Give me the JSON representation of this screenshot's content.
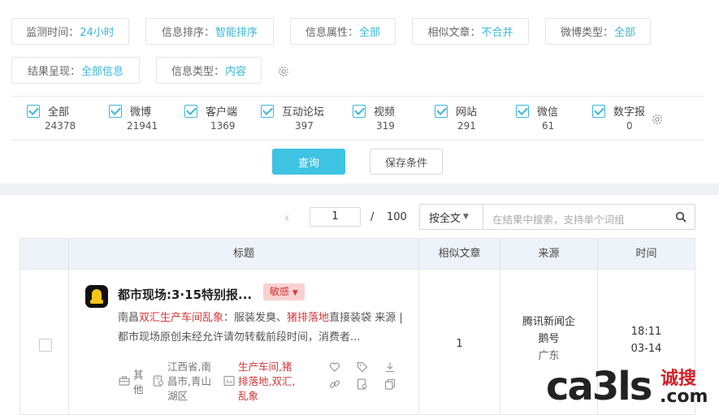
{
  "filters": {
    "monitor_time": {
      "label": "监测时间：",
      "value": "24小时"
    },
    "info_sort": {
      "label": "信息排序：",
      "value": "智能排序"
    },
    "info_attr": {
      "label": "信息属性：",
      "value": "全部"
    },
    "similar": {
      "label": "相似文章：",
      "value": "不合并"
    },
    "weibo_type": {
      "label": "微博类型：",
      "value": "全部"
    },
    "result_show": {
      "label": "结果呈现：",
      "value": "全部信息"
    },
    "info_type": {
      "label": "信息类型：",
      "value": "内容"
    }
  },
  "sources": [
    {
      "name": "全部",
      "count": "24378"
    },
    {
      "name": "微博",
      "count": "21941"
    },
    {
      "name": "客户端",
      "count": "1369"
    },
    {
      "name": "互动论坛",
      "count": "397"
    },
    {
      "name": "视频",
      "count": "319"
    },
    {
      "name": "网站",
      "count": "291"
    },
    {
      "name": "微信",
      "count": "61"
    },
    {
      "name": "数字报",
      "count": "0"
    }
  ],
  "buttons": {
    "query": "查询",
    "save": "保存条件"
  },
  "pager": {
    "prev": "‹",
    "current": "1",
    "sep": "/",
    "total": "100"
  },
  "search": {
    "scope": "按全文",
    "placeholder": "在结果中搜索，支持单个词组"
  },
  "table": {
    "headers": {
      "title": "标题",
      "similar": "相似文章",
      "source": "来源",
      "time": "时间"
    },
    "rows": [
      {
        "title": "都市现场:3·15特别报...",
        "badge": "敏感",
        "summary": {
          "p1": "南昌",
          "h1": "双汇生产车间乱象",
          "p2": "：服装发臭、",
          "h2": "猪排落地",
          "p3": "直接装袋 来源 | 都市现场原创未经允许请勿转载前段时间，消费者..."
        },
        "category_line1": "其",
        "category_line2": "他",
        "location": "江西省,南昌市,青山湖区",
        "keywords": "生产车间,猪排落地,双汇,乱象",
        "similar_count": "1",
        "source_line1": "腾讯新闻企",
        "source_line2": "鹅号",
        "source_line3": "广东",
        "time_line1": "18:11",
        "time_line2": "03-14"
      }
    ]
  },
  "watermark": {
    "main": "ca3ls",
    "cn": "诚搜",
    "com": ".com"
  },
  "colors": {
    "accent": "#3bb7da",
    "danger": "#d4373a",
    "button": "#3fc3e3"
  }
}
